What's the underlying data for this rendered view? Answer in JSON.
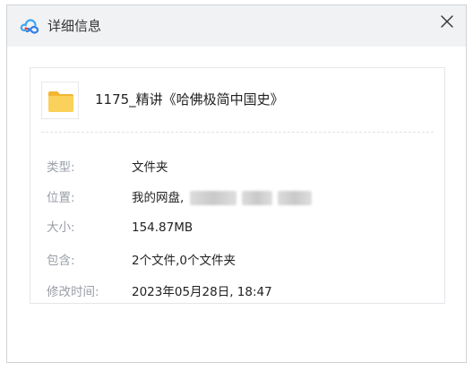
{
  "window": {
    "title": "详细信息",
    "close_icon": "close-icon",
    "logo_icon": "baidu-netdisk-logo-icon"
  },
  "file": {
    "icon": "folder-icon",
    "name": "1175_精讲《哈佛极简中国史》"
  },
  "details": [
    {
      "label": "类型:",
      "value": "文件夹"
    },
    {
      "label": "位置:",
      "value": "我的网盘,"
    },
    {
      "label": "大小:",
      "value": "154.87MB"
    },
    {
      "label": "包含:",
      "value": "2个文件,0个文件夹"
    },
    {
      "label": "修改时间:",
      "value": "2023年05月28日, 18:47"
    }
  ],
  "colors": {
    "titlebar_bg": "#f1f2f4",
    "folder_yellow": "#f7c948",
    "label_gray": "#9a9ea6"
  }
}
